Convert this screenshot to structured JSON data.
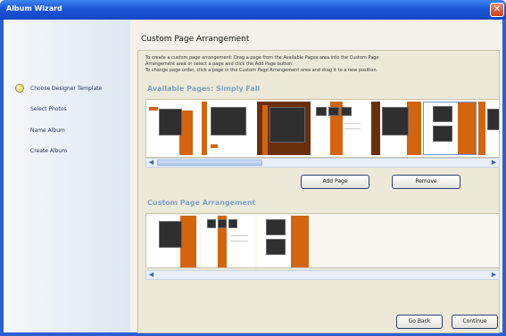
{
  "window": {
    "title": "Album Wizard",
    "close_glyph": "✕"
  },
  "sidebar": {
    "steps": [
      {
        "label": "Choose Designer Template"
      },
      {
        "label": "Select Photos"
      },
      {
        "label": "Name Album"
      },
      {
        "label": "Create Album"
      }
    ]
  },
  "main": {
    "heading": "Custom Page Arrangement",
    "instructions": [
      "To create a custom page arrangement: Drag a page from the Available Pages area into the Custom Page",
      "Arrangement area or select a page and click the Add Page button.",
      "To change page order, click a page in the Custom Page Arrangement area and drag it to a new position."
    ],
    "available_title": "Available Pages: Simply Fall",
    "custom_title": "Custom Page Arrangement",
    "add_page_label": "Add Page",
    "remove_label": "Remove"
  },
  "footer": {
    "back_label": "Go Back",
    "continue_label": "Continue"
  },
  "icons": {
    "scroll_left": "◀",
    "scroll_right": "▶"
  },
  "colors": {
    "accent_orange": "#d4640e",
    "title_blue": "#1b55d8",
    "section_blue": "#7da3c7"
  }
}
